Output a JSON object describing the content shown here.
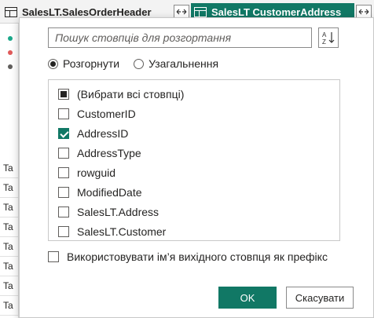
{
  "tables": {
    "left_header": "SalesLT.SalesOrderHeader",
    "right_header": "SalesLT CustomerAddress"
  },
  "colors": {
    "accent": "#117865",
    "dot_teal": "#1aa88a",
    "dot_red": "#e05a5a",
    "dot_dark": "#605e5c"
  },
  "row_labels": [
    "Ta",
    "Ta",
    "Ta",
    "Ta",
    "Ta",
    "Ta",
    "Ta",
    "Ta"
  ],
  "popup": {
    "search_placeholder": "Пошук стовпців для розгортання",
    "mode_expand": "Розгорнути",
    "mode_aggregate": "Узагальнення",
    "select_all": "(Вибрати всі стовпці)",
    "columns": [
      {
        "label": "CustomerID",
        "checked": false
      },
      {
        "label": "AddressID",
        "checked": true
      },
      {
        "label": "AddressType",
        "checked": false
      },
      {
        "label": "rowguid",
        "checked": false
      },
      {
        "label": "ModifiedDate",
        "checked": false
      },
      {
        "label": "SalesLT.Address",
        "checked": false
      },
      {
        "label": "SalesLT.Customer",
        "checked": false
      }
    ],
    "prefix_label": "Використовувати ім’я вихідного стовпця як префікс",
    "ok": "OK",
    "cancel": "Скасувати"
  }
}
